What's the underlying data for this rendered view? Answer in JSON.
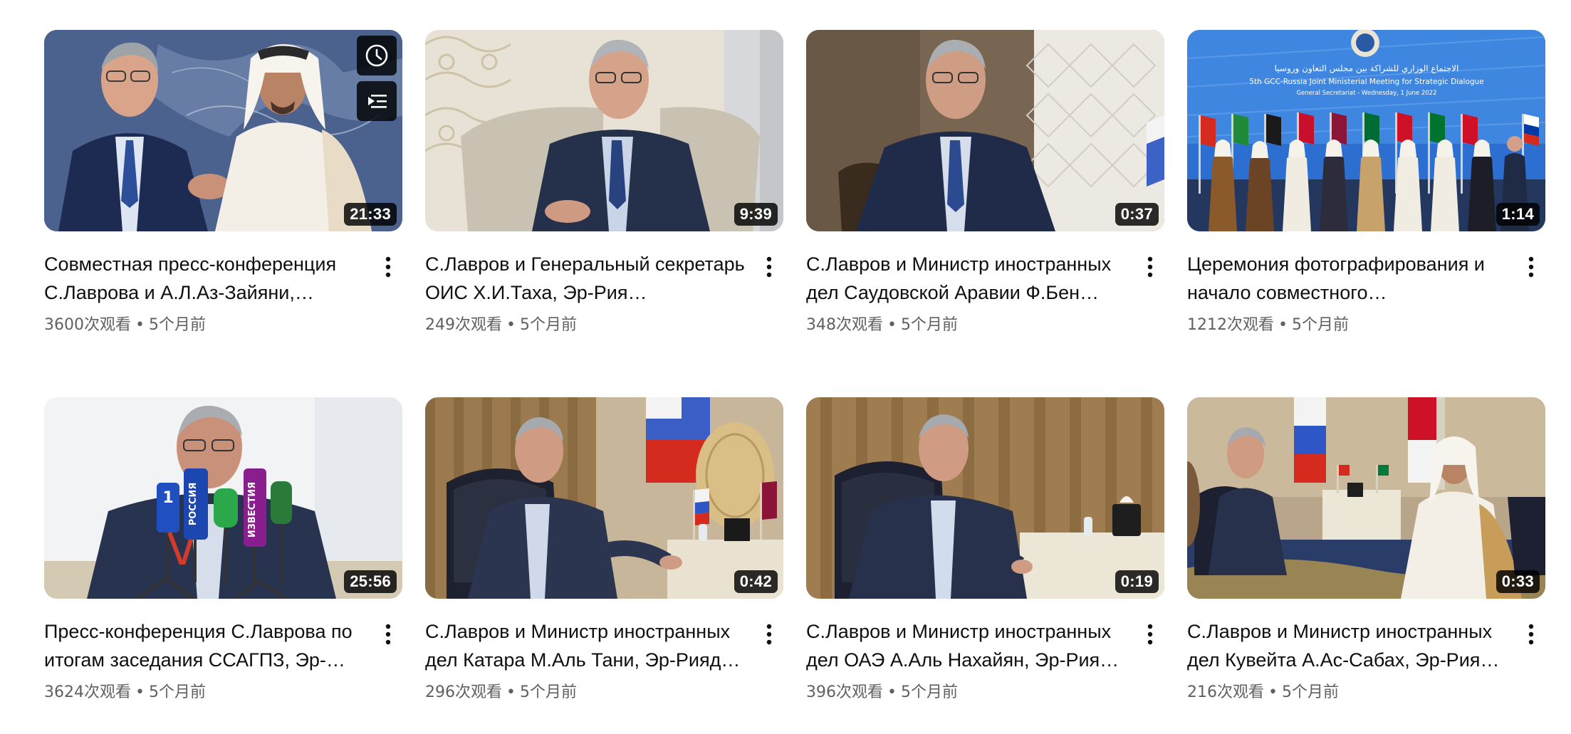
{
  "videos": [
    {
      "title": "Совместная пресс-конференция С.Лаврова и А.Л.Аз-Зайяни,…",
      "duration": "21:33",
      "views": "3600次观看",
      "separator": "•",
      "age": "5个月前"
    },
    {
      "title": "С.Лавров и Генеральный секретарь ОИС Х.И.Таха, Эр-Рия…",
      "duration": "9:39",
      "views": "249次观看",
      "separator": "•",
      "age": "5个月前"
    },
    {
      "title": "С.Лавров и Министр иностранных дел Саудовской Аравии Ф.Бен…",
      "duration": "0:37",
      "views": "348次观看",
      "separator": "•",
      "age": "5个月前"
    },
    {
      "title": "Церемония фотографирования и начало совместного…",
      "duration": "1:14",
      "views": "1212次观看",
      "separator": "•",
      "age": "5个月前"
    },
    {
      "title": "Пресс-конференция С.Лаврова по итогам заседания ССАГПЗ, Эр-…",
      "duration": "25:56",
      "views": "3624次观看",
      "separator": "•",
      "age": "5个月前"
    },
    {
      "title": "С.Лавров и Министр иностранных дел Катара М.Аль Тани, Эр-Рияд…",
      "duration": "0:42",
      "views": "296次观看",
      "separator": "•",
      "age": "5个月前"
    },
    {
      "title": "С.Лавров и Министр иностранных дел ОАЭ А.Аль Нахайян, Эр-Рия…",
      "duration": "0:19",
      "views": "396次观看",
      "separator": "•",
      "age": "5个月前"
    },
    {
      "title": "С.Лавров и Министр иностранных дел Кувейта А.Ас-Сабах, Эр-Рия…",
      "duration": "0:33",
      "views": "216次观看",
      "separator": "•",
      "age": "5个月前"
    }
  ],
  "thumbnail_banner": {
    "arabic_line": "الاجتماع الوزاري للشراكة بين مجلس التعاون وروسيا",
    "english_line1": "5th GCC-Russia Joint Ministerial Meeting for Strategic Dialogue",
    "english_line2": "General Secretariat - Wednesday, 1 June 2022"
  },
  "mic_labels": {
    "channel_one": "1",
    "russia": "РОССИЯ",
    "izvestia": "ИЗВЕСТИЯ"
  },
  "colors": {
    "title_text": "#0f0f0f",
    "meta_text": "#606060",
    "duration_bg": "#000000",
    "duration_text": "#ffffff"
  },
  "icons": {
    "watch_later": "clock-icon",
    "add_to_queue": "add-to-queue-icon",
    "menu": "more-vert-icon"
  }
}
